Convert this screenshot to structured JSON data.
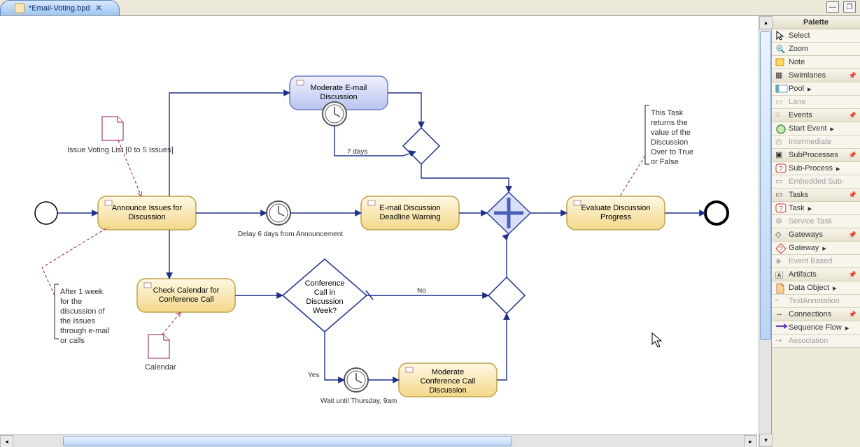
{
  "tab": {
    "title": "*Email-Voting.bpd"
  },
  "palette": {
    "title": "Palette",
    "select": "Select",
    "zoom": "Zoom",
    "note": "Note",
    "swimlanes_hdr": "Swimlanes",
    "pool": "Pool",
    "lane": "Lane",
    "events_hdr": "Events",
    "start_event": "Start Event",
    "intermediate": "Intermediate",
    "subproc_hdr": "SubProcesses",
    "subprocess": "Sub-Process",
    "embedded": "Embedded Sub-",
    "tasks_hdr": "Tasks",
    "task": "Task",
    "service_task": "Service Task",
    "gateways_hdr": "Gateways",
    "gateway": "Gateway",
    "event_based": "Event Based",
    "artifacts_hdr": "Artifacts",
    "data_object": "Data Object",
    "text_anno": "TextAnnotation",
    "connections_hdr": "Connections",
    "seq_flow": "Sequence Flow",
    "association": "Association"
  },
  "diagram": {
    "tasks": {
      "announce": "Announce Issues for Discussion",
      "moderate_email": "Moderate E-mail Discussion",
      "email_warning": "E-mail Discussion Deadline Warning",
      "check_cal": "Check Calendar for Conference Call",
      "moderate_conf": "Moderate Conference Call Discussion",
      "evaluate": "Evaluate Discussion Progress"
    },
    "gateways": {
      "conf_q": "Conference Call in Discussion Week?"
    },
    "labels": {
      "seven_days": "7 days",
      "delay6": "Delay 6 days from Announcement",
      "no": "No",
      "yes": "Yes",
      "wait_thursday": "Wait until Thursday, 9am"
    },
    "data_objects": {
      "issue_list": "Issue Voting List [0 to 5 Issues]",
      "calendar": "Calendar"
    },
    "annotations": {
      "after_week": "After 1 week for the discussion of the Issues through e-mail or calls",
      "task_returns": "This Task returns the value of the Discussion Over to True or False"
    }
  },
  "chart_data": {
    "type": "bpmn",
    "nodes": [
      {
        "id": "start",
        "type": "start-event",
        "label": ""
      },
      {
        "id": "announce",
        "type": "task",
        "label": "Announce Issues for Discussion"
      },
      {
        "id": "moderate_email",
        "type": "task",
        "label": "Moderate E-mail Discussion",
        "boundary_timer": "7 days",
        "selected": true
      },
      {
        "id": "timer_delay6",
        "type": "intermediate-timer",
        "label": "Delay 6 days from Announcement"
      },
      {
        "id": "email_warning",
        "type": "task",
        "label": "E-mail Discussion Deadline Warning"
      },
      {
        "id": "check_cal",
        "type": "task",
        "label": "Check Calendar for Conference Call"
      },
      {
        "id": "gw_conf",
        "type": "exclusive-gateway",
        "label": "Conference Call in Discussion Week?"
      },
      {
        "id": "gw_after_email",
        "type": "exclusive-gateway",
        "label": ""
      },
      {
        "id": "gw_after_conf",
        "type": "exclusive-gateway",
        "label": ""
      },
      {
        "id": "gw_parallel",
        "type": "parallel-gateway",
        "label": ""
      },
      {
        "id": "timer_wait_thu",
        "type": "intermediate-timer",
        "label": "Wait until Thursday, 9am"
      },
      {
        "id": "moderate_conf",
        "type": "task",
        "label": "Moderate Conference Call Discussion"
      },
      {
        "id": "evaluate",
        "type": "task",
        "label": "Evaluate Discussion Progress"
      },
      {
        "id": "end",
        "type": "end-event",
        "label": ""
      },
      {
        "id": "do_issue_list",
        "type": "data-object",
        "label": "Issue Voting List [0 to 5 Issues]"
      },
      {
        "id": "do_calendar",
        "type": "data-object",
        "label": "Calendar"
      },
      {
        "id": "anno_after_week",
        "type": "text-annotation",
        "label": "After 1 week for the discussion of the Issues through e-mail or calls"
      },
      {
        "id": "anno_task_returns",
        "type": "text-annotation",
        "label": "This Task returns the value of the Discussion Over to True or False"
      }
    ],
    "edges": [
      {
        "from": "start",
        "to": "announce",
        "type": "sequence"
      },
      {
        "from": "announce",
        "to": "moderate_email",
        "type": "sequence"
      },
      {
        "from": "announce",
        "to": "timer_delay6",
        "type": "sequence"
      },
      {
        "from": "announce",
        "to": "check_cal",
        "type": "sequence"
      },
      {
        "from": "moderate_email",
        "to": "gw_after_email",
        "type": "sequence"
      },
      {
        "from": "moderate_email_timer",
        "to": "gw_after_email",
        "type": "sequence",
        "label": "7 days"
      },
      {
        "from": "gw_after_email",
        "to": "gw_parallel",
        "type": "sequence"
      },
      {
        "from": "timer_delay6",
        "to": "email_warning",
        "type": "sequence"
      },
      {
        "from": "email_warning",
        "to": "gw_parallel",
        "type": "sequence"
      },
      {
        "from": "check_cal",
        "to": "gw_conf",
        "type": "sequence"
      },
      {
        "from": "gw_conf",
        "to": "gw_after_conf",
        "type": "sequence",
        "label": "No"
      },
      {
        "from": "gw_conf",
        "to": "timer_wait_thu",
        "type": "sequence",
        "label": "Yes"
      },
      {
        "from": "timer_wait_thu",
        "to": "moderate_conf",
        "type": "sequence"
      },
      {
        "from": "moderate_conf",
        "to": "gw_after_conf",
        "type": "sequence"
      },
      {
        "from": "gw_after_conf",
        "to": "gw_parallel",
        "type": "sequence"
      },
      {
        "from": "gw_parallel",
        "to": "evaluate",
        "type": "sequence"
      },
      {
        "from": "evaluate",
        "to": "end",
        "type": "sequence"
      },
      {
        "from": "do_issue_list",
        "to": "announce",
        "type": "association"
      },
      {
        "from": "do_calendar",
        "to": "check_cal",
        "type": "association"
      },
      {
        "from": "anno_after_week",
        "to": "announce",
        "type": "association"
      },
      {
        "from": "anno_task_returns",
        "to": "evaluate",
        "type": "association"
      }
    ]
  }
}
